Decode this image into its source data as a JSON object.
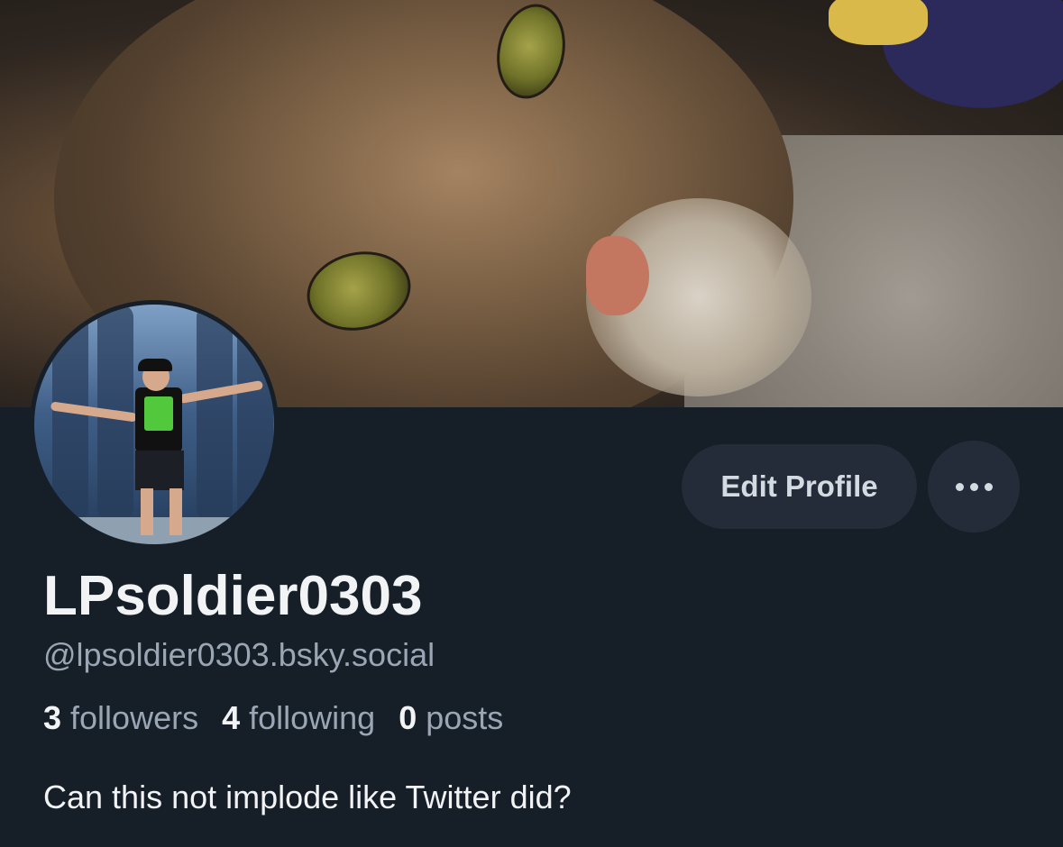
{
  "profile": {
    "display_name": "LPsoldier0303",
    "handle": "@lpsoldier0303.bsky.social",
    "bio": "Can this not implode like Twitter did?"
  },
  "stats": {
    "followers_count": "3",
    "followers_label": "followers",
    "following_count": "4",
    "following_label": "following",
    "posts_count": "0",
    "posts_label": "posts"
  },
  "actions": {
    "edit_profile_label": "Edit Profile",
    "more_icon": "more-horizontal-icon"
  },
  "colors": {
    "background": "#161e27",
    "button_bg": "#232c38",
    "primary_text": "#f1f3f5",
    "secondary_text": "#9aa6b4"
  }
}
